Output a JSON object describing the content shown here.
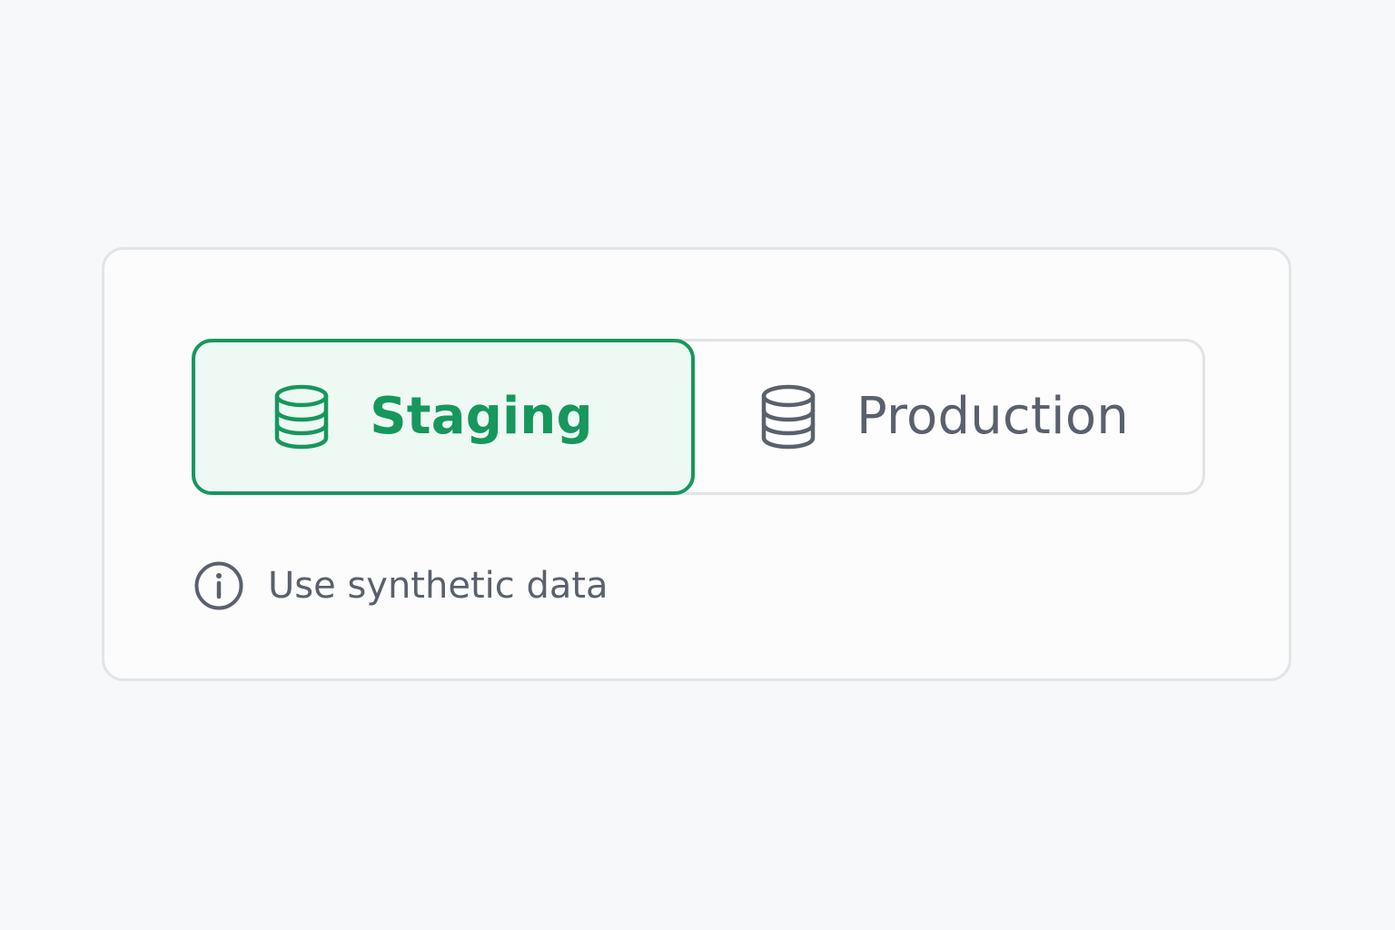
{
  "environment_selector": {
    "options": [
      {
        "label": "Staging",
        "icon": "database-icon",
        "selected": true
      },
      {
        "label": "Production",
        "icon": "database-icon",
        "selected": false
      }
    ]
  },
  "hint": {
    "icon": "info-icon",
    "text": "Use synthetic data"
  },
  "colors": {
    "accent": "#16975c",
    "accent_background": "#eef9f3",
    "muted_text": "#5a616c",
    "border": "#e3e4e6",
    "background": "#f7f8f9"
  }
}
